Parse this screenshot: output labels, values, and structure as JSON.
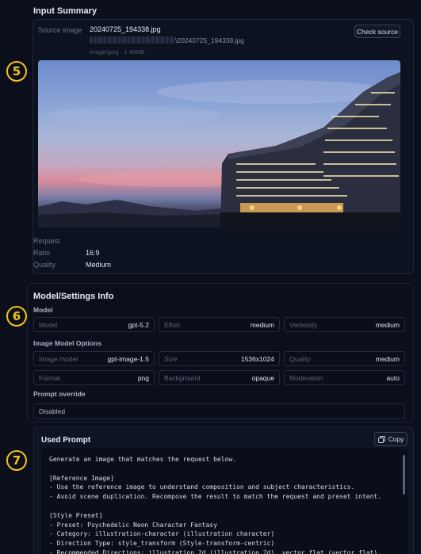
{
  "input_summary": {
    "title": "Input Summary",
    "source_label": "Source image",
    "file_name": "20240725_194338.jpg",
    "file_path": "\\20240725_194338.jpg",
    "file_meta": "image/jpeg · 1.49MB",
    "check_source_label": "Check source",
    "request_label": "Request",
    "ratio_label": "Ratio",
    "ratio_value": "16:9",
    "quality_label": "Quality",
    "quality_value": "Medium"
  },
  "model_settings": {
    "title": "Model/Settings Info",
    "model_section": "Model",
    "fields_row1": [
      {
        "k": "Model",
        "v": "gpt-5.2"
      },
      {
        "k": "Effort",
        "v": "medium"
      },
      {
        "k": "Verbosity",
        "v": "medium"
      }
    ],
    "image_options_section": "Image Model Options",
    "fields_row2": [
      {
        "k": "Image model",
        "v": "gpt-image-1.5"
      },
      {
        "k": "Size",
        "v": "1536x1024"
      },
      {
        "k": "Quality",
        "v": "medium"
      }
    ],
    "fields_row3": [
      {
        "k": "Format",
        "v": "png"
      },
      {
        "k": "Background",
        "v": "opaque"
      },
      {
        "k": "Moderation",
        "v": "auto"
      }
    ],
    "override_section": "Prompt override",
    "override_value": "Disabled"
  },
  "used_prompt": {
    "title": "Used Prompt",
    "copy_label": "Copy",
    "text": "Generate an image that matches the request below.\n\n[Reference Image]\n- Use the reference image to understand composition and subject characteristics.\n- Avoid scene duplication. Recompose the result to match the request and preset intent.\n\n[Style Preset]\n- Preset: Psychedelic Neon Character Fantasy\n- Category: illustration-character (illustration character)\n- Direction Type: style_transform (Style-transform-centric)\n- Recommended Directions: illustration_2d (illustration_2d), vector_flat (vector_flat),"
  },
  "badges": {
    "b5": "5",
    "b6": "6",
    "b7": "7"
  },
  "colors": {
    "badge": "#f2c318",
    "background": "#0b0f1c"
  }
}
